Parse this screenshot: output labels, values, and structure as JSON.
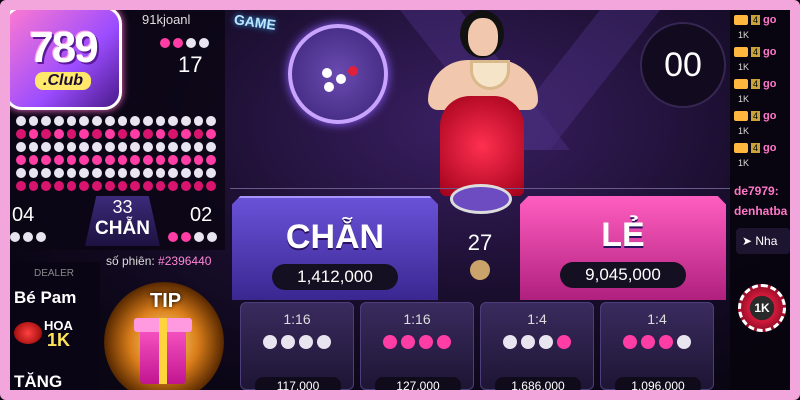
{
  "brand": {
    "logo_number": "789",
    "logo_sub": ".Club"
  },
  "header": {
    "username": "91kjoanl",
    "game_badge": "GAME",
    "timer": "00"
  },
  "road": {
    "top_count": "17",
    "rows": [
      [
        "w",
        "w",
        "w",
        "w",
        "w",
        "w",
        "w",
        "w",
        "w",
        "w",
        "w",
        "w",
        "w",
        "w",
        "w",
        "w"
      ],
      [
        "r",
        "p",
        "r",
        "p",
        "r",
        "p",
        "r",
        "p",
        "r",
        "p",
        "r",
        "p",
        "r",
        "p",
        "r",
        "p"
      ],
      [
        "w",
        "w",
        "w",
        "w",
        "w",
        "w",
        "w",
        "w",
        "w",
        "w",
        "w",
        "w",
        "w",
        "w",
        "w",
        "w"
      ],
      [
        "p",
        "p",
        "p",
        "p",
        "p",
        "p",
        "p",
        "p",
        "p",
        "p",
        "p",
        "p",
        "p",
        "p",
        "p",
        "p"
      ],
      [
        "w",
        "w",
        "w",
        "w",
        "w",
        "w",
        "w",
        "w",
        "w",
        "w",
        "w",
        "w",
        "w",
        "w",
        "w",
        "w"
      ],
      [
        "r",
        "r",
        "r",
        "r",
        "r",
        "r",
        "r",
        "r",
        "r",
        "r",
        "r",
        "r",
        "r",
        "r",
        "r",
        "r"
      ]
    ]
  },
  "summary": {
    "left_count": "04",
    "right_count": "02",
    "center_count": "33",
    "center_label": "CHẴN"
  },
  "session": {
    "label": "số phiên:",
    "value": "#2396440"
  },
  "dealer": {
    "label": "DEALER",
    "name": "Bé Pam",
    "hoa": "HOA",
    "hoa_value": "1K",
    "tang": "TĂNG"
  },
  "tip": {
    "label": "TIP"
  },
  "bets": {
    "chan": {
      "label": "CHẴN",
      "amount": "1,412,000"
    },
    "le": {
      "label": "LẺ",
      "amount": "9,045,000"
    },
    "players": "27"
  },
  "side_bets": [
    {
      "odds": "1:16",
      "beads": [
        "w",
        "w",
        "w",
        "w"
      ],
      "amount": "117,000"
    },
    {
      "odds": "1:16",
      "beads": [
        "p",
        "p",
        "p",
        "p"
      ],
      "amount": "127,000"
    },
    {
      "odds": "1:4",
      "beads": [
        "w",
        "w",
        "w",
        "p"
      ],
      "amount": "1,686,000"
    },
    {
      "odds": "1:4",
      "beads": [
        "p",
        "p",
        "p",
        "w"
      ],
      "amount": "1,096,000"
    }
  ],
  "chat": {
    "entries": [
      {
        "level": "1K",
        "badge": "4",
        "text": "go"
      },
      {
        "level": "1K",
        "badge": "4",
        "text": "go"
      },
      {
        "level": "1K",
        "badge": "4",
        "text": "go"
      },
      {
        "level": "1K",
        "badge": "4",
        "text": "go"
      },
      {
        "level": "1K",
        "badge": "4",
        "text": "go"
      }
    ],
    "user1": "de7979:",
    "user2": "denhatba",
    "send_label": "Nha",
    "chip_label": "1K"
  },
  "colors": {
    "frame": "#f3a6dc",
    "chan": "#6a52d8",
    "le": "#ff5ec0",
    "white_bead": "#e8e4f0",
    "pink_bead": "#ff3da5"
  }
}
